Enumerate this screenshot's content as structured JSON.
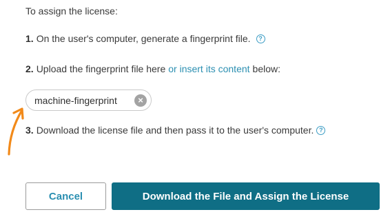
{
  "intro": "To assign the license:",
  "steps": {
    "step1": {
      "number": "1.",
      "text": "On the user's computer, generate a fingerprint file."
    },
    "step2": {
      "number": "2.",
      "text_before": "Upload the fingerprint file here",
      "link": "or insert its content",
      "text_after": "below:"
    },
    "step3": {
      "number": "3.",
      "text": "Download the license file and then pass it to the user's computer."
    }
  },
  "help_icon_glyph": "?",
  "chip": {
    "label": "machine-fingerprint",
    "remove_glyph": "×"
  },
  "buttons": {
    "cancel": "Cancel",
    "primary": "Download the File and Assign the License"
  },
  "colors": {
    "accent": "#2b8fb1",
    "primary_button": "#0f6e85",
    "annotation_arrow": "#f28a1a"
  },
  "icons": [
    "help-circle-icon",
    "remove-circle-icon",
    "annotation-arrow-icon"
  ]
}
